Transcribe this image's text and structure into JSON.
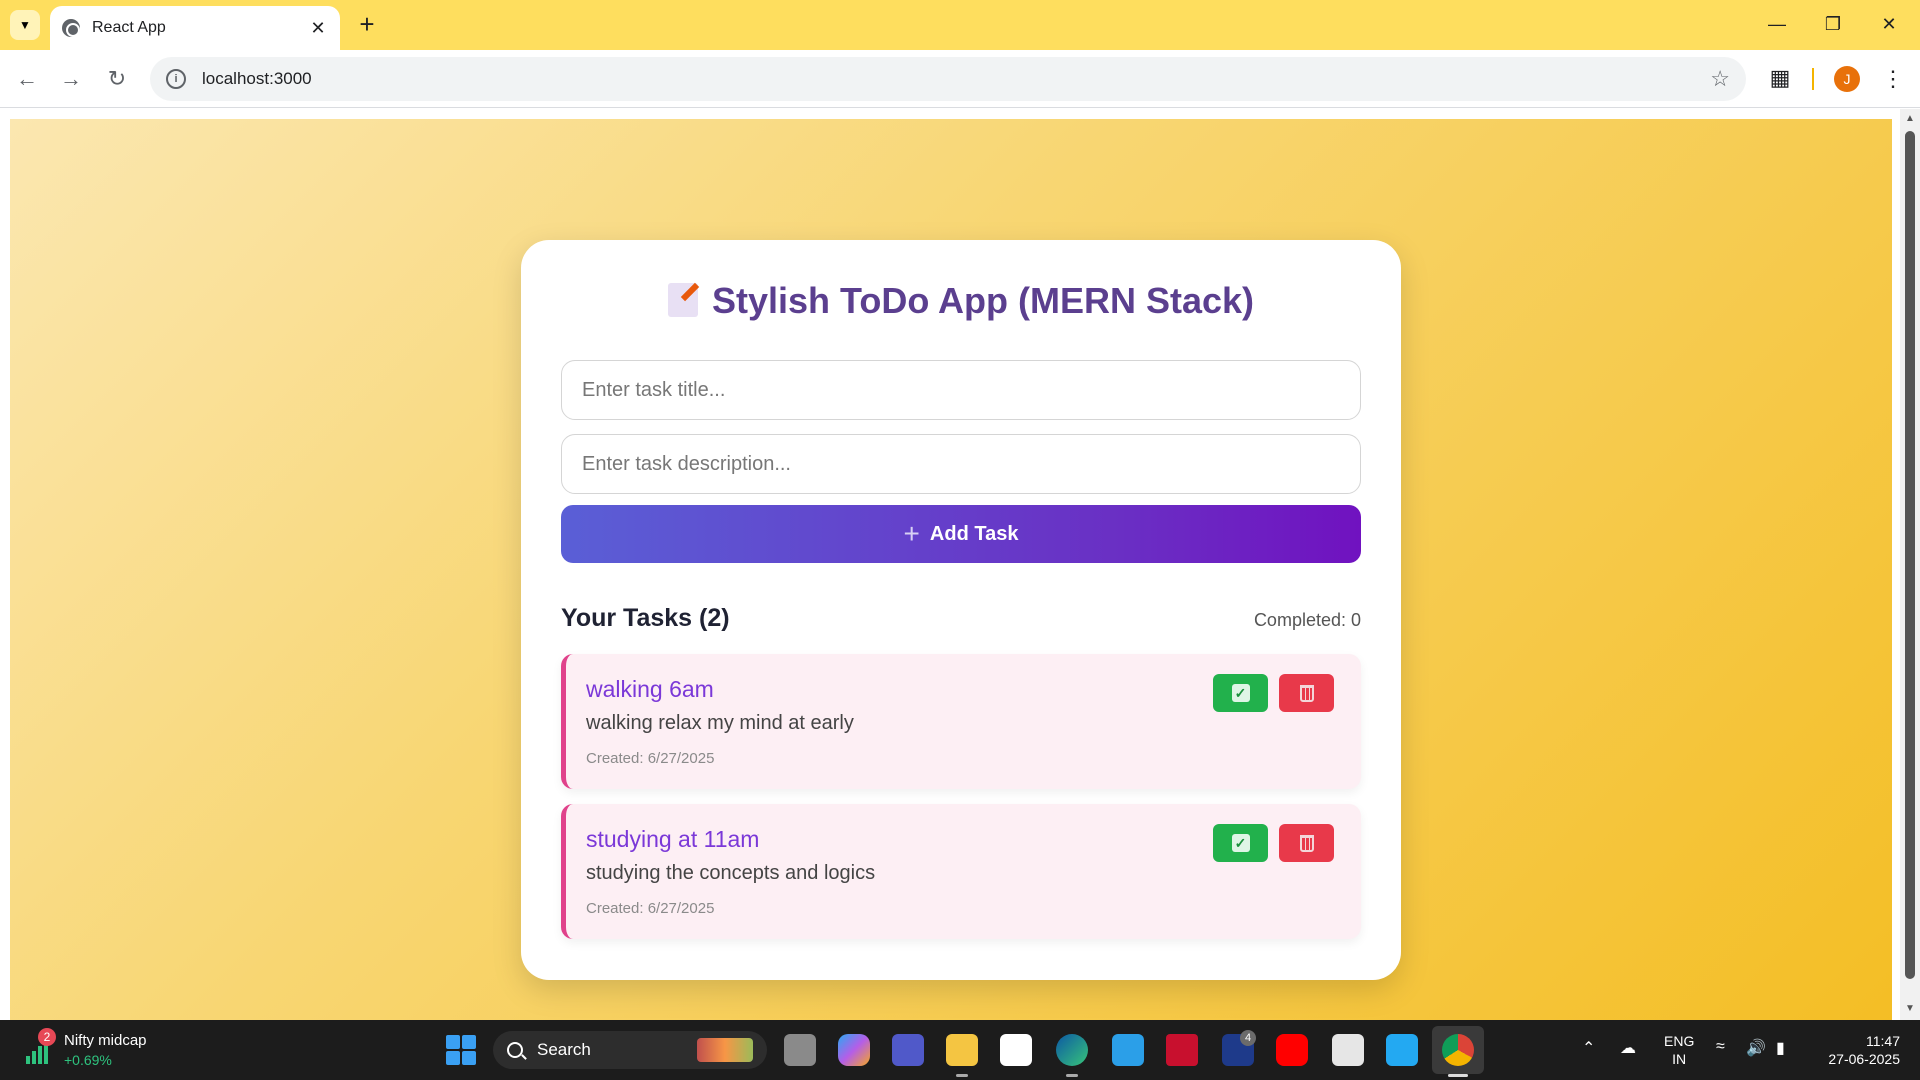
{
  "browser": {
    "tab_title": "React App",
    "url": "localhost:3000"
  },
  "profile_initial": "J",
  "app": {
    "title": "Stylish ToDo App (MERN Stack)",
    "title_placeholder": "Enter task title...",
    "description_placeholder": "Enter task description...",
    "add_label": "Add Task",
    "tasks_heading": "Your Tasks (2)",
    "completed_label": "Completed: 0",
    "tasks": [
      {
        "title": "walking 6am",
        "description": "walking relax my mind at early",
        "created": "Created: 6/27/2025"
      },
      {
        "title": "studying at 11am",
        "description": "studying the concepts and logics",
        "created": "Created: 6/27/2025"
      }
    ]
  },
  "taskbar": {
    "widget_badge": "2",
    "widget_name": "Nifty midcap",
    "widget_change": "+0.69%",
    "search_label": "Search",
    "teams_badge": "4",
    "language": "ENG",
    "region": "IN",
    "time": "11:47",
    "date": "27-06-2025"
  },
  "colors": {
    "accent_purple": "#6a2fc4",
    "task_border": "#e0428b",
    "done_green": "#22b14c",
    "delete_red": "#e8394a"
  }
}
